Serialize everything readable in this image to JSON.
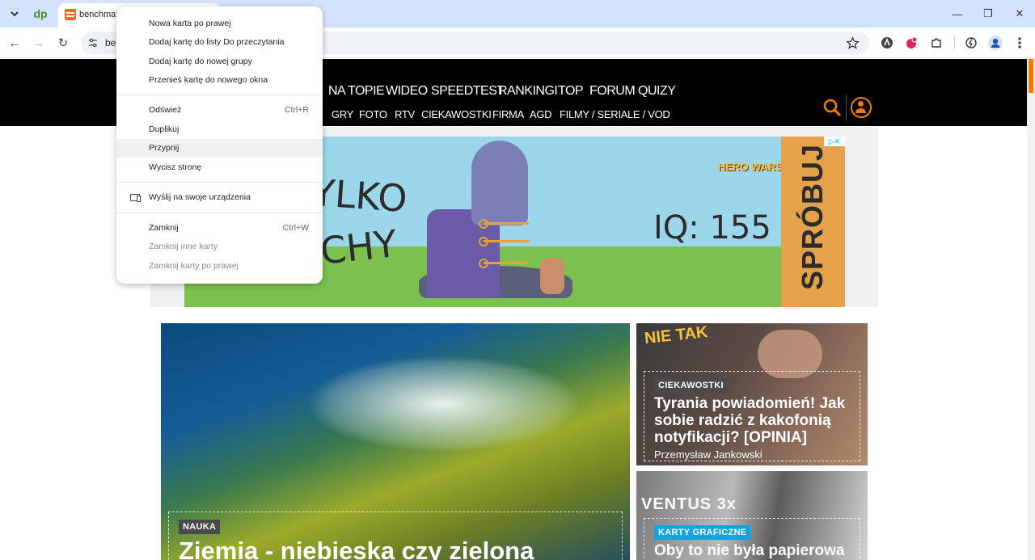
{
  "browser": {
    "pinned_tab_label": "dp",
    "active_tab_title": "benchmark",
    "url_partial": "be",
    "window_controls": {
      "minimize": "—",
      "maximize": "❐",
      "close": "✕"
    },
    "nav": {
      "back": "←",
      "forward": "→",
      "reload": "↻"
    }
  },
  "site": {
    "nav_primary": [
      "NA TOPIE",
      "WIDEO",
      "SPEEDTEST",
      "RANKINGI",
      "TOP",
      "FORUM",
      "QUIZY"
    ],
    "nav_secondary": [
      "GRY",
      "FOTO",
      "RTV",
      "CIEKAWOSTKI",
      "FIRMA",
      "AGD",
      "FILMY / SERIALE / VOD"
    ],
    "accent_color": "#f57c00"
  },
  "ad": {
    "text_top": "TYLKO",
    "text_bottom": "CHY",
    "iq": "IQ: 155",
    "cta": "SPRÓBUJ",
    "brand": "HERO WARS"
  },
  "articles": {
    "main": {
      "tag": "NAUKA",
      "title": "Ziemia - niebieska czy zielona"
    },
    "side1": {
      "tag": "CIEKAWOSTKI",
      "title": "Tyrania powiadomień! Jak sobie radzić z kakofonią notyfikacji? [OPINIA]",
      "author": "Przemysław Jankowski",
      "overlay": "NIE TAK"
    },
    "side2": {
      "tag": "KARTY GRAFICZNE",
      "title": "Oby to nie była papierowa",
      "overlay": "VENTUS 3x"
    }
  },
  "context_menu": {
    "items": [
      {
        "label": "Nowa karta po prawej",
        "shortcut": ""
      },
      {
        "label": "Dodaj kartę do listy Do przeczytania",
        "shortcut": ""
      },
      {
        "label": "Dodaj kartę do nowej grupy",
        "shortcut": ""
      },
      {
        "label": "Przenieś kartę do nowego okna",
        "shortcut": ""
      },
      {
        "label": "Odśwież",
        "shortcut": "Ctrl+R"
      },
      {
        "label": "Duplikuj",
        "shortcut": ""
      },
      {
        "label": "Przypnij",
        "shortcut": ""
      },
      {
        "label": "Wycisz stronę",
        "shortcut": ""
      },
      {
        "label": "Wyślij na swoje urządzenia",
        "shortcut": ""
      },
      {
        "label": "Zamknij",
        "shortcut": "Ctrl+W"
      },
      {
        "label": "Zamknij inne karty",
        "shortcut": ""
      },
      {
        "label": "Zamknij karty po prawej",
        "shortcut": ""
      }
    ]
  }
}
